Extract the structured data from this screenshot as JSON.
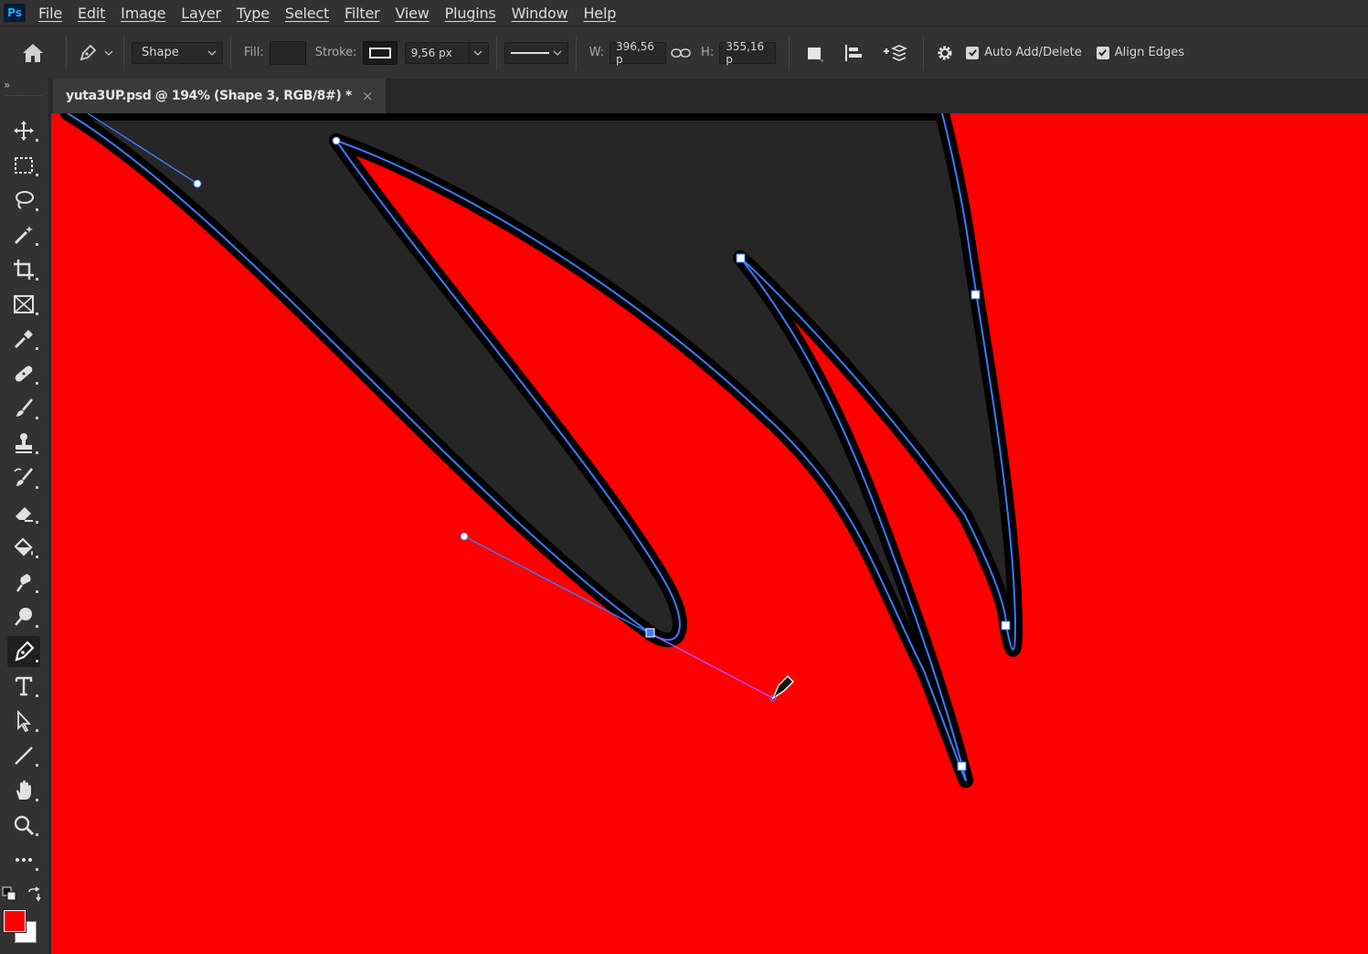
{
  "app": {
    "logo": "Ps"
  },
  "menu": [
    "File",
    "Edit",
    "Image",
    "Layer",
    "Type",
    "Select",
    "Filter",
    "View",
    "Plugins",
    "Window",
    "Help"
  ],
  "options": {
    "mode": "Shape",
    "fill_label": "Fill:",
    "stroke_label": "Stroke:",
    "stroke_width": "9,56 px",
    "w_label": "W:",
    "w_value": "396,56 p",
    "h_label": "H:",
    "h_value": "355,16 p",
    "auto_add_delete": "Auto Add/Delete",
    "align_edges": "Align Edges"
  },
  "document_tab": {
    "title": "yuta3UP.psd @ 194% (Shape 3, RGB/8#) *",
    "close": "×"
  },
  "colors": {
    "canvas": "#ff0000",
    "shape_fill": "#262626",
    "shape_stroke": "#000000",
    "path": "#3a7bff",
    "foreground": "#ff0000",
    "background": "#ffffff"
  },
  "tools": [
    {
      "name": "move-tool",
      "icon": "move-icon"
    },
    {
      "name": "marquee-tool",
      "icon": "rect-marquee-icon"
    },
    {
      "name": "lasso-tool",
      "icon": "lasso-icon"
    },
    {
      "name": "magic-wand-tool",
      "icon": "magic-wand-icon"
    },
    {
      "name": "crop-tool",
      "icon": "crop-icon"
    },
    {
      "name": "frame-tool",
      "icon": "frame-icon"
    },
    {
      "name": "eyedropper-tool",
      "icon": "eyedropper-icon"
    },
    {
      "name": "healing-brush-tool",
      "icon": "bandage-icon"
    },
    {
      "name": "brush-tool",
      "icon": "brush-icon"
    },
    {
      "name": "clone-stamp-tool",
      "icon": "stamp-icon"
    },
    {
      "name": "history-brush-tool",
      "icon": "history-brush-icon"
    },
    {
      "name": "eraser-tool",
      "icon": "eraser-icon"
    },
    {
      "name": "paint-bucket-tool",
      "icon": "bucket-icon"
    },
    {
      "name": "smudge-tool",
      "icon": "smudge-icon"
    },
    {
      "name": "dodge-tool",
      "icon": "dodge-icon"
    },
    {
      "name": "pen-tool",
      "icon": "pen-icon",
      "active": true
    },
    {
      "name": "type-tool",
      "icon": "type-icon"
    },
    {
      "name": "path-selection-tool",
      "icon": "arrow-icon"
    },
    {
      "name": "line-tool",
      "icon": "line-icon"
    },
    {
      "name": "hand-tool",
      "icon": "hand-icon"
    },
    {
      "name": "zoom-tool",
      "icon": "zoom-icon"
    },
    {
      "name": "more-tools",
      "icon": "ellipsis-icon"
    }
  ]
}
